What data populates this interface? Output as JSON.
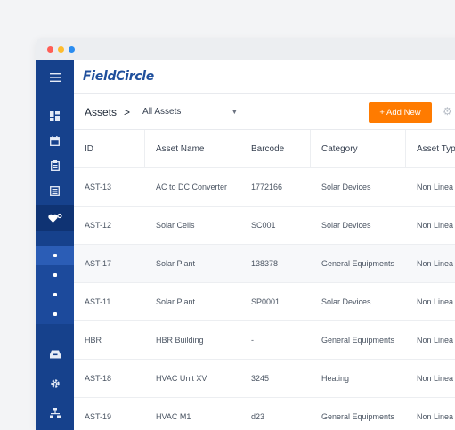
{
  "window": {
    "traffic_lights": [
      "#ff5f57",
      "#febc2e",
      "#2a8cf0"
    ]
  },
  "app": {
    "logo_text": "FieldCircle"
  },
  "sidebar": {
    "icons": [
      "menu-icon",
      "dashboard-icon",
      "calendar-icon",
      "clipboard-icon",
      "list-icon",
      "asset-heart-icon",
      "sub-item",
      "sub-item",
      "sub-item",
      "sub-item",
      "inbox-icon",
      "settings-icon",
      "network-icon"
    ]
  },
  "breadcrumb": {
    "root": "Assets",
    "separator": ">",
    "current": "All Assets"
  },
  "toolbar": {
    "add_label": "+ Add New",
    "accent": "#ff7b00"
  },
  "table": {
    "columns": [
      "ID",
      "Asset Name",
      "Barcode",
      "Category",
      "Asset Typ"
    ],
    "rows": [
      [
        "AST-13",
        "AC to DC Converter",
        "1772166",
        "Solar Devices",
        "Non Linea"
      ],
      [
        "AST-12",
        "Solar Cells",
        "SC001",
        "Solar Devices",
        "Non Linea"
      ],
      [
        "AST-17",
        "Solar Plant",
        "138378",
        "General Equipments",
        "Non Linea"
      ],
      [
        "AST-11",
        "Solar Plant",
        "SP0001",
        "Solar Devices",
        "Non Linea"
      ],
      [
        "HBR",
        "HBR Building",
        "-",
        "General Equipments",
        "Non Linea"
      ],
      [
        "AST-18",
        "HVAC Unit XV",
        "3245",
        "Heating",
        "Non Linea"
      ],
      [
        "AST-19",
        "HVAC M1",
        "d23",
        "General Equipments",
        "Non Linea"
      ]
    ]
  }
}
